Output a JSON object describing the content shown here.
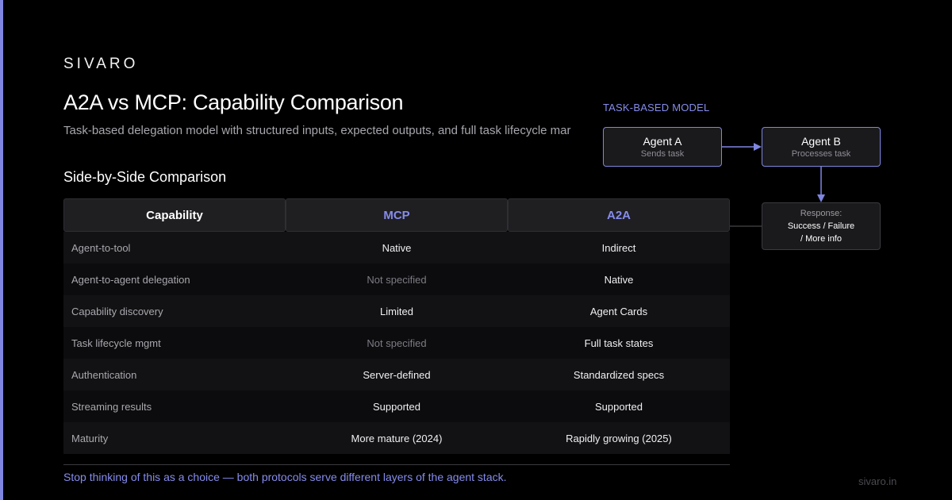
{
  "brand": "SIVARO",
  "title": "A2A vs MCP: Capability Comparison",
  "subtitle": "Task-based delegation model with structured inputs, expected outputs, and full task lifecycle mar",
  "section_title": "Side-by-Side Comparison",
  "table": {
    "headers": [
      "Capability",
      "MCP",
      "A2A"
    ],
    "rows": [
      {
        "capability": "Agent-to-tool",
        "mcp": "Native",
        "a2a": "Indirect"
      },
      {
        "capability": "Agent-to-agent delegation",
        "mcp": "Not specified",
        "a2a": "Native"
      },
      {
        "capability": "Capability discovery",
        "mcp": "Limited",
        "a2a": "Agent Cards"
      },
      {
        "capability": "Task lifecycle mgmt",
        "mcp": "Not specified",
        "a2a": "Full task states"
      },
      {
        "capability": "Authentication",
        "mcp": "Server-defined",
        "a2a": "Standardized specs"
      },
      {
        "capability": "Streaming results",
        "mcp": "Supported",
        "a2a": "Supported"
      },
      {
        "capability": "Maturity",
        "mcp": "More mature (2024)",
        "a2a": "Rapidly growing (2025)"
      }
    ]
  },
  "diagram": {
    "label": "TASK-BASED MODEL",
    "agent_a": {
      "name": "Agent A",
      "desc": "Sends task"
    },
    "agent_b": {
      "name": "Agent B",
      "desc": "Processes task"
    },
    "response": {
      "title": "Response:",
      "line1": "Success / Failure",
      "line2": "/ More info"
    }
  },
  "footer": {
    "note": "Stop thinking of this as a choice — both protocols serve different layers of the agent stack.",
    "url": "sivaro.in"
  },
  "colors": {
    "accent": "#7f86e0",
    "protocol_header": "#868cec",
    "background": "#000000"
  }
}
